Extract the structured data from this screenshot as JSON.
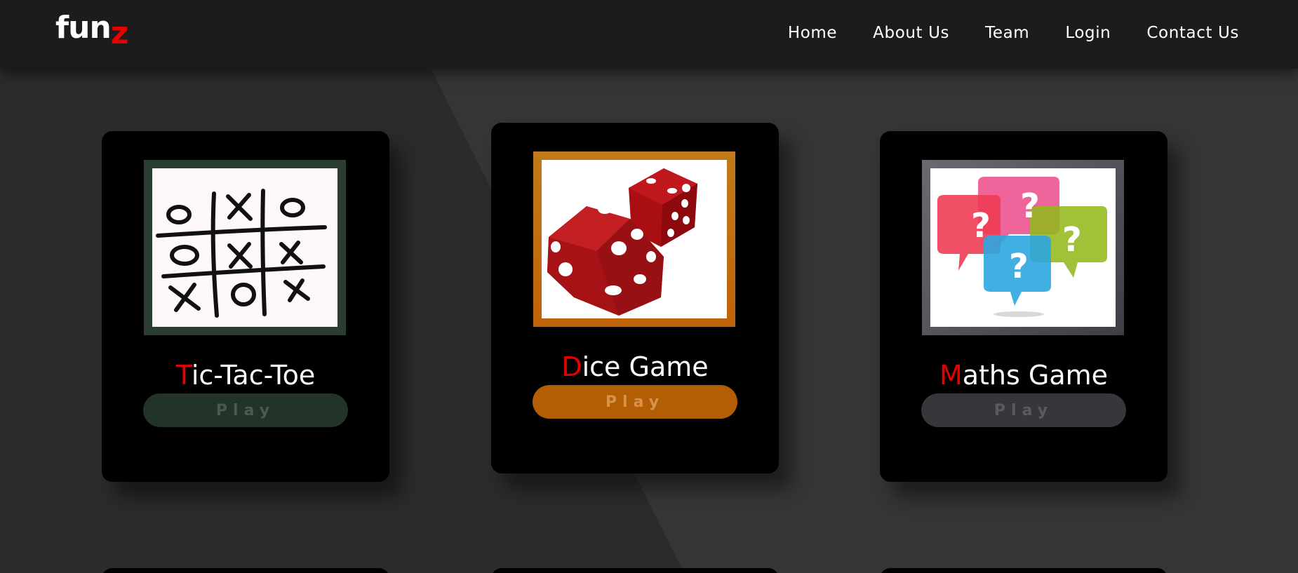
{
  "nav": {
    "logo_main": "fun",
    "logo_accent": "z",
    "links": [
      "Home",
      "About Us",
      "Team",
      "Login",
      "Contact Us"
    ]
  },
  "colors": {
    "accent": "#e60000",
    "tictactoe_frame": "#233328",
    "dice_frame": "#c4720f",
    "maths_frame": "#4a4a52",
    "tictactoe_button_text": "#4a5a4e",
    "dice_button_text": "#d9924a",
    "maths_button_text": "#5c5a60"
  },
  "cards": [
    {
      "title_first": "T",
      "title_rest": "ic-Tac-Toe",
      "button": "Play",
      "button_bg": "#223328",
      "icon": "tic-tac-toe-board-image"
    },
    {
      "title_first": "D",
      "title_rest": "ice Game",
      "button": "Play",
      "button_bg": "#b35d05",
      "icon": "red-dice-image"
    },
    {
      "title_first": "M",
      "title_rest": "aths Game",
      "button": "Play",
      "button_bg": "#38363a",
      "icon": "question-speech-bubbles-image"
    }
  ]
}
